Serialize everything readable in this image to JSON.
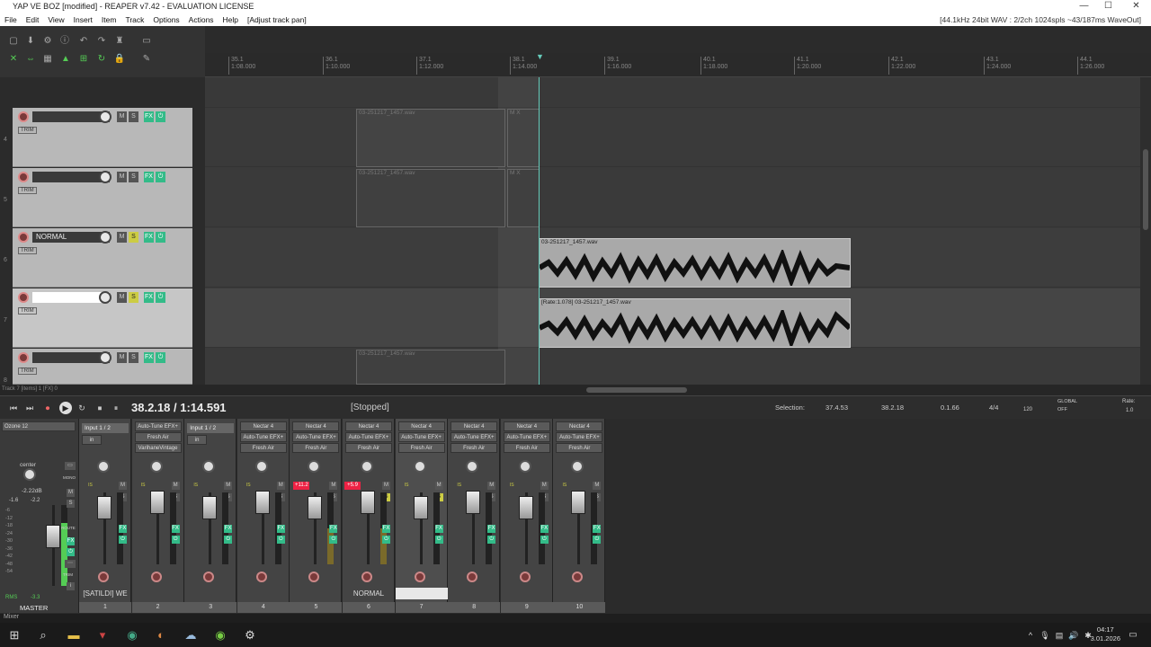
{
  "window": {
    "title": "YAP VE BOZ [modified] - REAPER v7.42 - EVALUATION LICENSE",
    "minimize": "—",
    "maximize": "☐",
    "close": "✕"
  },
  "menu": {
    "items": [
      "File",
      "Edit",
      "View",
      "Insert",
      "Item",
      "Track",
      "Options",
      "Actions",
      "Help"
    ],
    "extra": "[Adjust track pan]",
    "audio_status": "[44.1kHz 24bit WAV : 2/2ch 1024spls ~43/187ms WaveOut]"
  },
  "ruler": {
    "markers": [
      {
        "bar": "35.1",
        "time": "1:08.000"
      },
      {
        "bar": "36.1",
        "time": "1:10.000"
      },
      {
        "bar": "37.1",
        "time": "1:12.000"
      },
      {
        "bar": "38.1",
        "time": "1:14.000"
      },
      {
        "bar": "39.1",
        "time": "1:16.000"
      },
      {
        "bar": "40.1",
        "time": "1:18.000"
      },
      {
        "bar": "41.1",
        "time": "1:20.000"
      },
      {
        "bar": "42.1",
        "time": "1:22.000"
      },
      {
        "bar": "43.1",
        "time": "1:24.000"
      },
      {
        "bar": "44.1",
        "time": "1:26.000"
      }
    ]
  },
  "tracks": [
    {
      "num": "4",
      "name": "",
      "trim": "TRIM"
    },
    {
      "num": "5",
      "name": "",
      "trim": "TRIM"
    },
    {
      "num": "6",
      "name": "NORMAL",
      "trim": "TRIM"
    },
    {
      "num": "7",
      "name": "",
      "trim": "TRIM"
    },
    {
      "num": "8",
      "name": "",
      "trim": "TRIM"
    }
  ],
  "track_buttons": {
    "mute": "M",
    "solo": "S",
    "fx": "FX",
    "phase": "⏻"
  },
  "items": {
    "take_file": "03-251217_1457.wav",
    "rate_label": "[Rate:1.078] 03-251217_1457.wav",
    "item_flags": "M X"
  },
  "footer_hint": "Track 7 [items] 1 [FX] 0",
  "transport": {
    "position": "38.2.18 / 1:14.591",
    "status": "[Stopped]",
    "selection_label": "Selection:",
    "selection_start": "37.4.53",
    "selection_end": "38.2.18",
    "selection_length": "0.1.66",
    "time_sig": "4/4",
    "bpm": "120",
    "global": "GLOBAL",
    "global_state": "OFF",
    "rate_label": "Rate:",
    "rate_value": "1.0"
  },
  "master": {
    "plugin": "Ozone 12",
    "pan_label": "center",
    "peak": "-2.22dB",
    "left_db": "-1.6",
    "right_db": "-2.2",
    "rms_label": "RMS",
    "rms_value": "-3.3",
    "mono": "MONO",
    "route": "ROUTE",
    "trim": "TRIM",
    "name": "MASTER",
    "scale": [
      "-6",
      "-12",
      "-18",
      "-24",
      "-30",
      "-36",
      "-42",
      "-48",
      "-54"
    ]
  },
  "mixer": {
    "strips": [
      {
        "num": "1",
        "name": "[SATILDI] WE",
        "fx": [
          "Input 1 / 2",
          "",
          ""
        ],
        "clip": ""
      },
      {
        "num": "2",
        "name": "",
        "fx": [
          "Auto-Tune EFX+",
          "Fresh Air",
          "VarihaneVintage"
        ],
        "clip": ""
      },
      {
        "num": "3",
        "name": "",
        "fx": [
          "Input 1 / 2",
          "",
          ""
        ],
        "clip": ""
      },
      {
        "num": "4",
        "name": "",
        "fx": [
          "Nectar 4",
          "Auto-Tune EFX+",
          "Fresh Air"
        ],
        "clip": ""
      },
      {
        "num": "5",
        "name": "",
        "fx": [
          "Nectar 4",
          "Auto-Tune EFX+",
          "Fresh Air"
        ],
        "clip": "+11.2"
      },
      {
        "num": "6",
        "name": "NORMAL",
        "fx": [
          "Nectar 4",
          "Auto-Tune EFX+",
          "Fresh Air"
        ],
        "clip": "+5.9"
      },
      {
        "num": "7",
        "name": "",
        "fx": [
          "Nectar 4",
          "Auto-Tune EFX+",
          "Fresh Air"
        ],
        "clip": ""
      },
      {
        "num": "8",
        "name": "",
        "fx": [
          "Nectar 4",
          "Auto-Tune EFX+",
          "Fresh Air"
        ],
        "clip": ""
      },
      {
        "num": "9",
        "name": "",
        "fx": [
          "Nectar 4",
          "Auto-Tune EFX+",
          "Fresh Air"
        ],
        "clip": ""
      },
      {
        "num": "10",
        "name": "",
        "fx": [
          "Nectar 4",
          "Auto-Tune EFX+",
          "Fresh Air"
        ],
        "clip": ""
      }
    ],
    "io_label": "in",
    "strip_buttons": {
      "mute": "M",
      "solo": "S",
      "fx": "FX",
      "phase": "⏻"
    }
  },
  "mixer_tab": "Mixer",
  "taskbar": {
    "time": "04:17",
    "date": "3.01.2026"
  }
}
